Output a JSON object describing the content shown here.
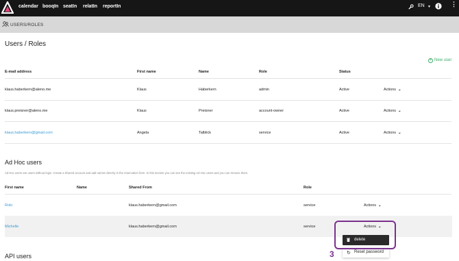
{
  "nav": {
    "items": [
      "calendar",
      "booqIn",
      "seatIn",
      "relatIn",
      "reportIn"
    ],
    "lang": "EN"
  },
  "breadcrumb": {
    "label": "USERS/ROLES"
  },
  "page": {
    "title": "Users / Roles",
    "new_user": "New user"
  },
  "users_table": {
    "headers": [
      "E-mail address",
      "First name",
      "Name",
      "Role",
      "Status"
    ],
    "rows": [
      {
        "email": "klaus.haberkern@aleno.me",
        "first": "Klaus",
        "name": "Haberkern",
        "role": "admin",
        "status": "Active",
        "actions": "Actions"
      },
      {
        "email": "klaus.preisner@aleno.me",
        "first": "Klaus",
        "name": "Preisner",
        "role": "account-owner",
        "status": "Active",
        "actions": "Actions"
      },
      {
        "email": "klaus.haberkern@gmail.com",
        "first": "Angela",
        "name": "Talblick",
        "role": "service",
        "status": "Active",
        "actions": "Actions"
      }
    ]
  },
  "adhoc": {
    "title": "Ad Hoc users",
    "description": "Ad Hoc users are users without login. Create a Shared account and add names directly in the reservation form. In this section you can see the existing Ad Hoc users and you can remove them.",
    "headers": [
      "First name",
      "Name",
      "Shared From",
      "Role"
    ],
    "rows": [
      {
        "first": "Rolo",
        "name": "",
        "shared": "klaus.haberkern@gmail.com",
        "role": "service",
        "actions": "Actions"
      },
      {
        "first": "Michelle",
        "name": "",
        "shared": "klaus.haberkern@gmail.com",
        "role": "service",
        "actions": "Actions"
      }
    ]
  },
  "menu": {
    "delete": "delete",
    "reset": "Reset password"
  },
  "api": {
    "title": "API users"
  },
  "annotation": {
    "number": "3"
  },
  "colors": {
    "accent_green": "#3fae6a",
    "link_blue": "#3a9bd5",
    "annotation_purple": "#7a2f8f"
  }
}
